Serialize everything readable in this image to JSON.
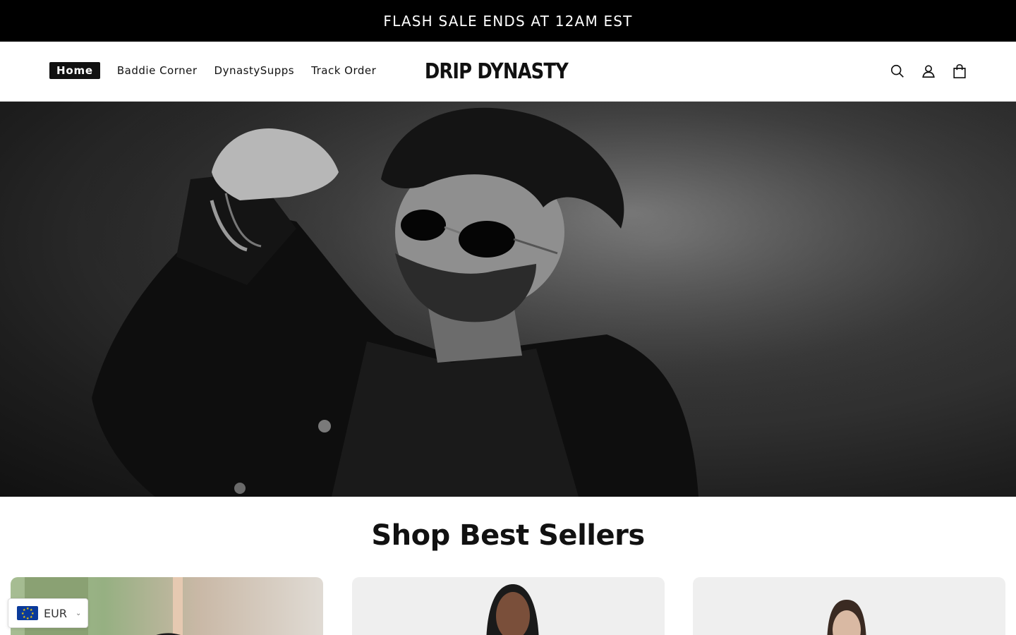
{
  "announcement": {
    "text": "FLASH SALE ENDS AT 12AM EST"
  },
  "nav": {
    "items": [
      {
        "label": "Home"
      },
      {
        "label": "Baddie Corner"
      },
      {
        "label": "DynastySupps"
      },
      {
        "label": "Track Order"
      }
    ]
  },
  "brand": {
    "logo_text": "DRIP DYNASTY"
  },
  "header_icons": [
    "search-icon",
    "account-icon",
    "cart-icon"
  ],
  "section": {
    "title": "Shop Best Sellers"
  },
  "currency": {
    "code": "EUR",
    "flag": "eu-flag-icon"
  },
  "colors": {
    "announcement_bg": "#000000",
    "text": "#111111",
    "accent_active": "#111111"
  }
}
